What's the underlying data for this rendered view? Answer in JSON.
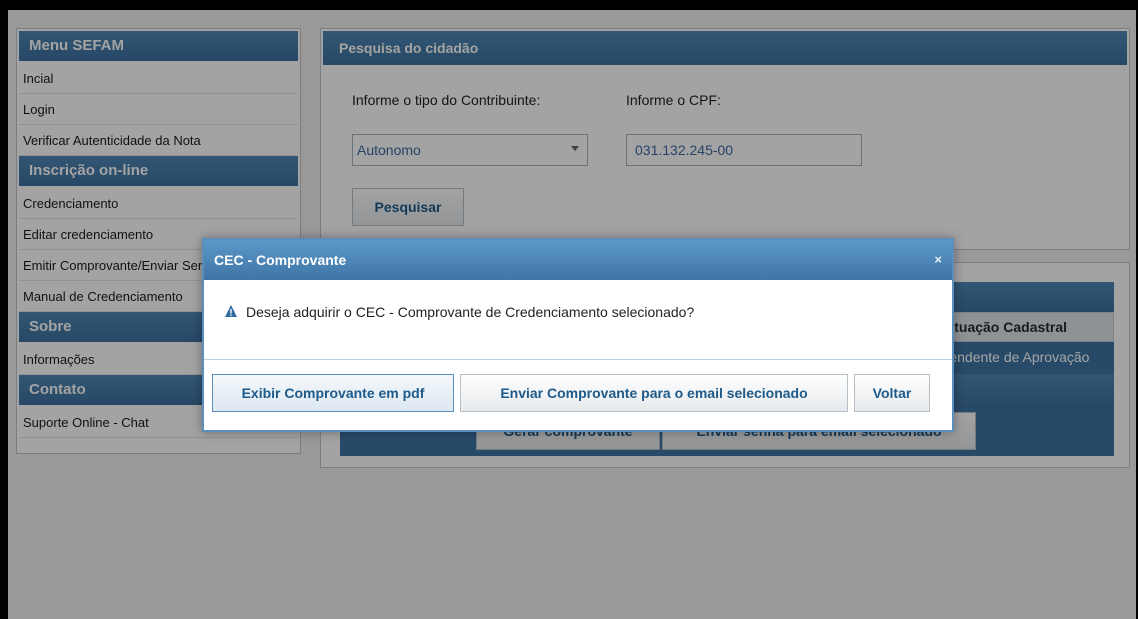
{
  "sidebar": {
    "sections": [
      {
        "title": "Menu SEFAM",
        "items": [
          "Incial",
          "Login",
          "Verificar Autenticidade da Nota"
        ]
      },
      {
        "title": "Inscrição on-line",
        "items": [
          "Credenciamento",
          "Editar credenciamento",
          "Emitir Comprovante/Enviar Senha",
          "Manual de Credenciamento"
        ]
      },
      {
        "title": "Sobre",
        "items": [
          "Informações"
        ]
      },
      {
        "title": "Contato",
        "items": [
          "Suporte Online - Chat"
        ]
      }
    ]
  },
  "search": {
    "panel_title": "Pesquisa do cidadão",
    "type_label": "Informe o tipo do Contribuinte:",
    "cpf_label": "Informe o CPF:",
    "type_value": "Autonomo",
    "cpf_value": "031.132.245-00",
    "search_button": "Pesquisar"
  },
  "results": {
    "column_header": "Situação Cadastral",
    "row_value": "Pendente de Aprovação",
    "generate_button": "Gerar comprovante",
    "send_password_button": "Enviar senha para email selecionado"
  },
  "dialog": {
    "title": "CEC - Comprovante",
    "close": "×",
    "message": "Deseja adquirir o CEC - Comprovante de Credenciamento selecionado?",
    "pdf_button": "Exibir Comprovante em pdf",
    "email_button": "Enviar Comprovante para o email selecionado",
    "back_button": "Voltar"
  },
  "colors": {
    "header_blue": "#3d72a0",
    "dialog_border": "#5a8fbd",
    "warning_blue": "#2f6aa0"
  }
}
